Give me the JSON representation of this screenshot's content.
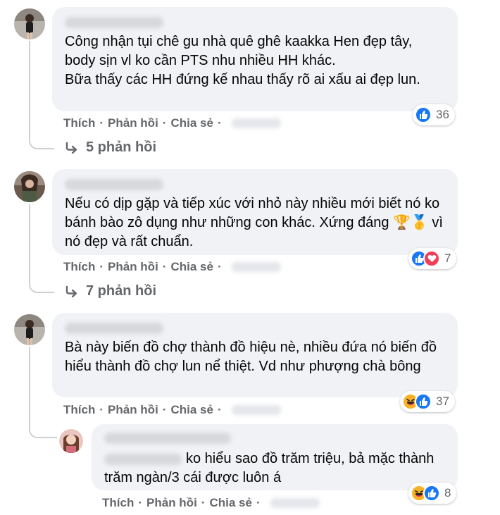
{
  "comments": [
    {
      "text": "Công nhận tụi chê gu nhà quê ghê kaakka Hen đẹp tây, body sịn vl ko cần PTS nhu nhiều HH khác.\nBữa thấy các HH đứng kế nhau thấy rõ ai xấu ai đẹp lun.",
      "reaction_count": "36",
      "reaction_types": [
        "like"
      ],
      "replies_label": "5 phản hồi"
    },
    {
      "text": "Nếu có dịp gặp và tiếp xúc với nhỏ này nhiều mới biết nó ko bánh bào zô dụng như những con khác. Xứng đáng 🏆🥇 vì nó đẹp và rất chuẩn.",
      "reaction_count": "7",
      "reaction_types": [
        "like",
        "love"
      ],
      "replies_label": "7 phản hồi"
    },
    {
      "text": "Bà này biến đồ chợ thành đồ hiệu nè, nhiều đứa nó biến đồ hiểu thành đồ chợ lun nể thiệt. Vd như phượng chà bông",
      "reaction_count": "37",
      "reaction_types": [
        "haha",
        "like"
      ]
    }
  ],
  "reply": {
    "text": "ko hiểu sao đồ trăm triệu, bả mặc thành trăm ngàn/3 cái được luôn á",
    "reaction_count": "8",
    "reaction_types": [
      "haha",
      "like"
    ]
  },
  "actions": {
    "like": "Thích",
    "reply": "Phản hồi",
    "share": "Chia sẻ",
    "separator": "·"
  },
  "colors": {
    "bubble": "#f0f2f5",
    "secondary_text": "#65676b",
    "like_blue": "#1877f2",
    "love_red": "#f33e58",
    "haha_yellow": "#f7b125"
  }
}
